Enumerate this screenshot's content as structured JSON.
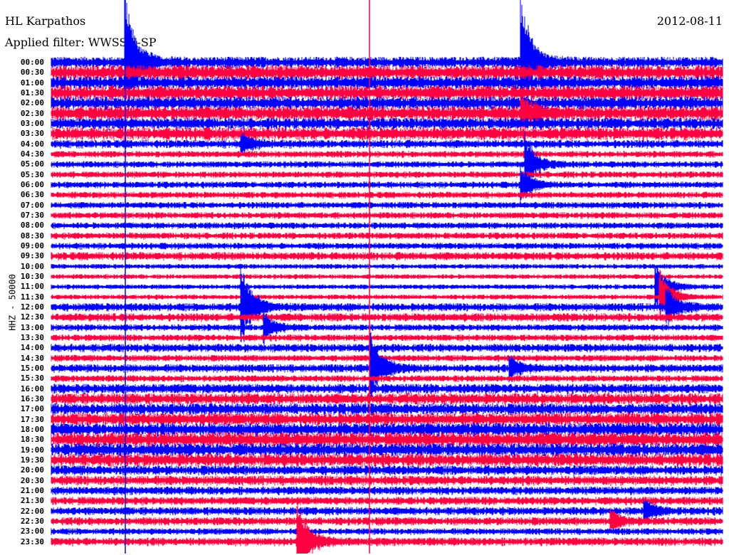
{
  "header": {
    "station": "HL Karpathos",
    "filter": "Applied filter: WWSSN-SP",
    "date": "2012-08-11"
  },
  "chart_data": {
    "type": "line",
    "title": "HL Karpathos",
    "ylabel": "HHZ - 50000",
    "xlabel": "",
    "minutes_per_line": 30,
    "colors": [
      "#0000ff",
      "#ff0040"
    ],
    "tick_labels": [
      "00:00",
      "00:30",
      "01:00",
      "01:30",
      "02:00",
      "02:30",
      "03:00",
      "03:30",
      "04:00",
      "04:30",
      "05:00",
      "05:30",
      "06:00",
      "06:30",
      "07:00",
      "07:30",
      "08:00",
      "08:30",
      "09:00",
      "09:30",
      "10:00",
      "10:30",
      "11:00",
      "11:30",
      "12:00",
      "12:30",
      "13:00",
      "13:30",
      "14:00",
      "14:30",
      "15:00",
      "15:30",
      "16:00",
      "16:30",
      "17:00",
      "17:30",
      "18:00",
      "18:30",
      "19:00",
      "19:30",
      "20:00",
      "20:30",
      "21:00",
      "21:30",
      "22:00",
      "22:30",
      "23:00",
      "23:30"
    ],
    "noise_level": [
      7,
      9,
      8,
      9,
      8,
      9,
      7,
      8,
      5,
      4,
      4,
      4,
      4,
      4,
      4,
      4,
      4,
      4,
      4,
      5,
      3,
      3,
      3,
      3,
      5,
      5,
      4,
      4,
      5,
      4,
      5,
      4,
      6,
      7,
      7,
      8,
      8,
      9,
      8,
      8,
      6,
      6,
      5,
      5,
      5,
      5,
      4,
      5
    ],
    "events": [
      {
        "line": 0,
        "minute": 3.3,
        "amplitude": 90
      },
      {
        "line": 0,
        "minute": 21.0,
        "amplitude": 90
      },
      {
        "line": 5,
        "minute": 21.0,
        "amplitude": 25
      },
      {
        "line": 10,
        "minute": 21.2,
        "amplitude": 40
      },
      {
        "line": 12,
        "minute": 21.0,
        "amplitude": 25
      },
      {
        "line": 8,
        "minute": 8.5,
        "amplitude": 15
      },
      {
        "line": 22,
        "minute": 27.0,
        "amplitude": 35
      },
      {
        "line": 23,
        "minute": 27.2,
        "amplitude": 40
      },
      {
        "line": 24,
        "minute": 8.5,
        "amplitude": 60
      },
      {
        "line": 24,
        "minute": 27.5,
        "amplitude": 30
      },
      {
        "line": 26,
        "minute": 9.5,
        "amplitude": 20
      },
      {
        "line": 30,
        "minute": 14.3,
        "amplitude": 50
      },
      {
        "line": 30,
        "minute": 20.5,
        "amplitude": 18
      },
      {
        "line": 44,
        "minute": 26.5,
        "amplitude": 15
      },
      {
        "line": 45,
        "minute": 25.0,
        "amplitude": 15
      },
      {
        "line": 47,
        "minute": 11.0,
        "amplitude": 60
      }
    ]
  }
}
